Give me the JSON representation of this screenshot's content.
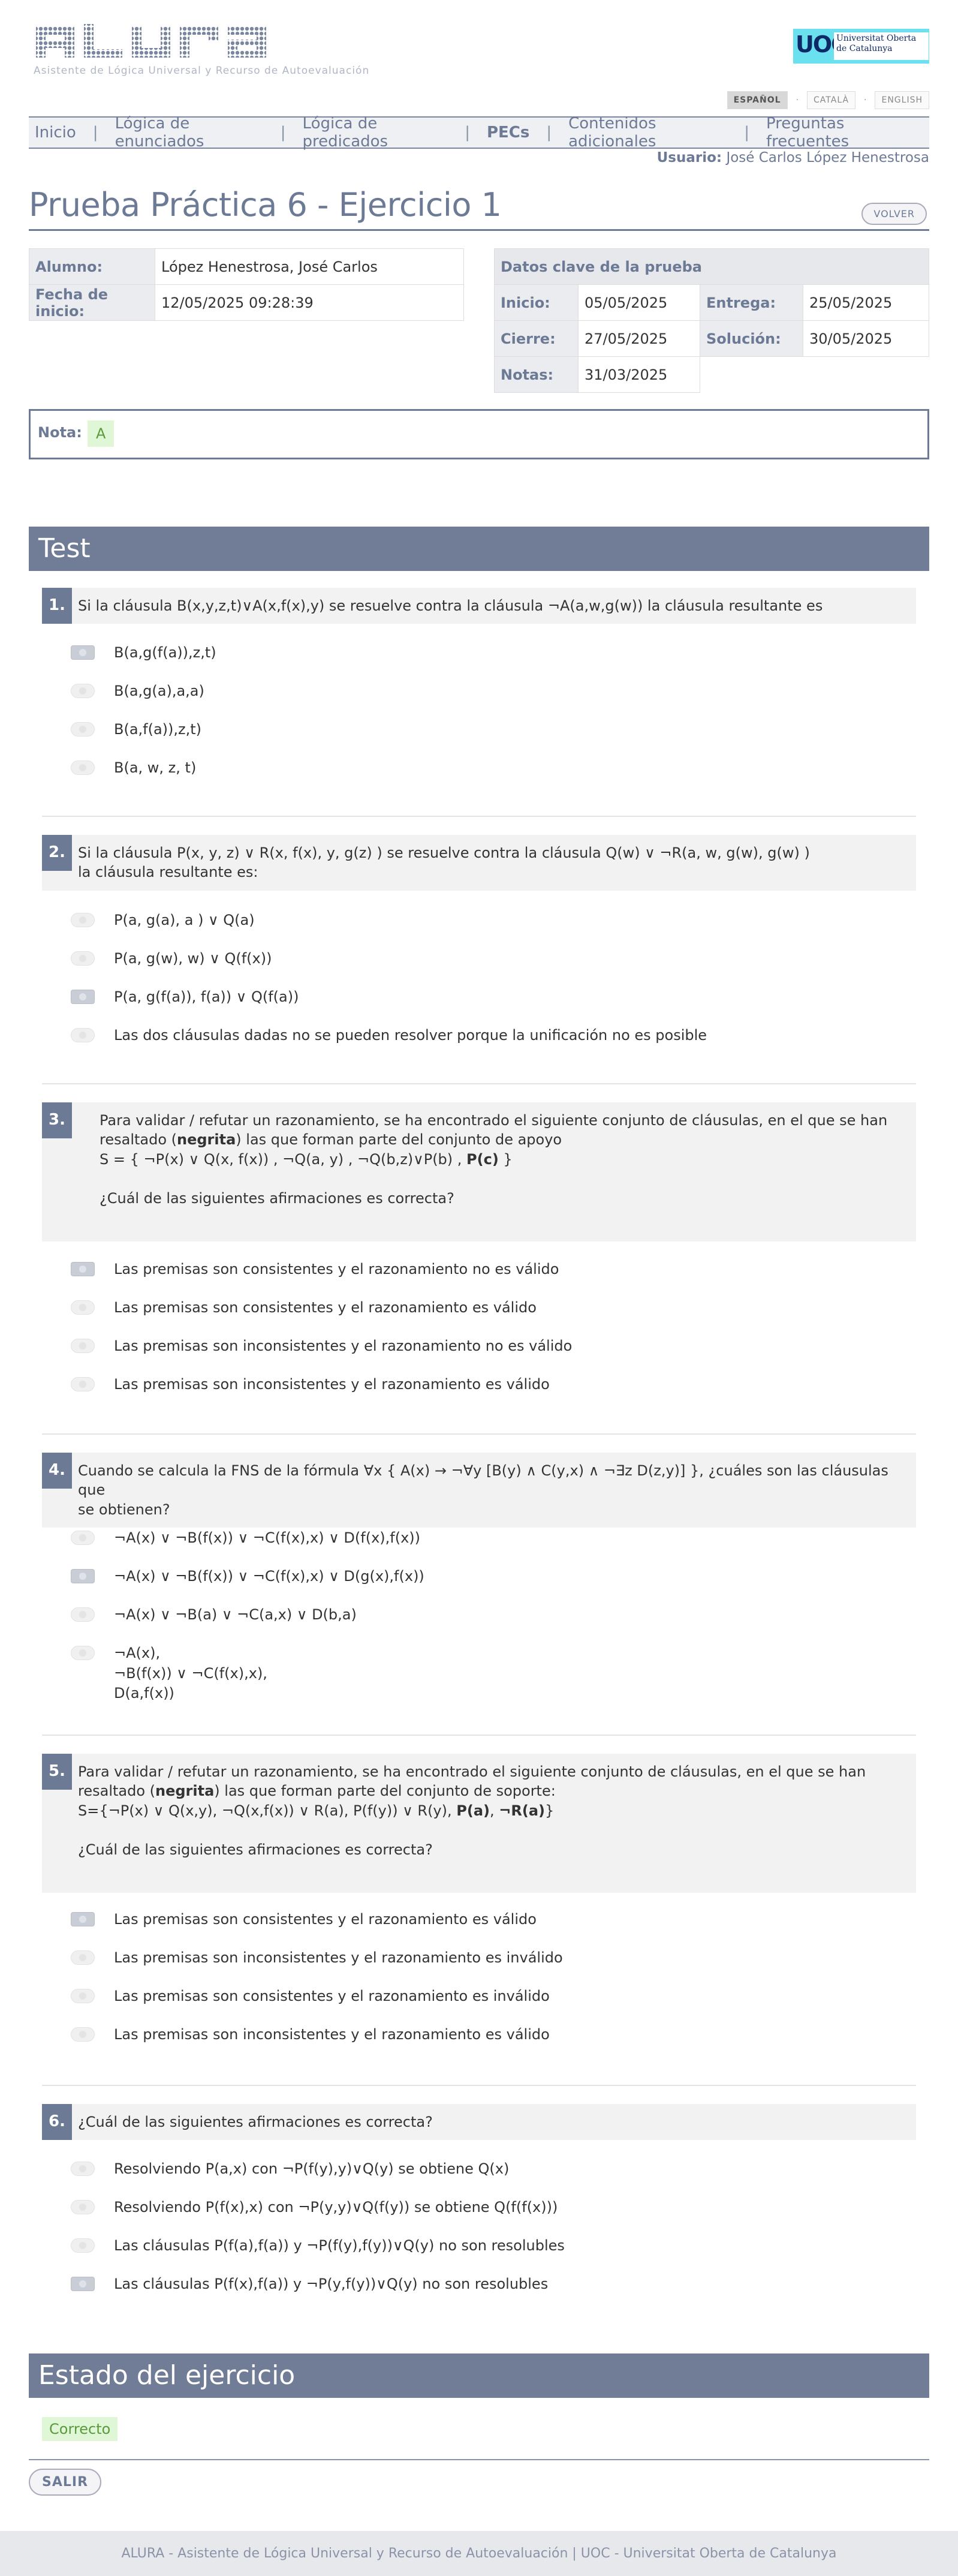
{
  "app": {
    "logo_text": "ALURA",
    "logo_subtitle": "Asistente de Lógica Universal y Recurso de Autoevaluación",
    "university": "Universitat Oberta de Catalunya"
  },
  "languages": [
    "ESPAÑOL",
    "CATALÀ",
    "ENGLISH"
  ],
  "nav": [
    "Inicio",
    "Lógica de enunciados",
    "Lógica de predicados",
    "PECs",
    "Contenidos adicionales",
    "Preguntas frecuentes"
  ],
  "user": {
    "label": "Usuario:",
    "name": "José Carlos López Henestrosa"
  },
  "page_title": "Prueba Práctica 6 - Ejercicio 1",
  "back_button": "VOLVER",
  "student": {
    "alumno_label": "Alumno:",
    "alumno": "López Henestrosa, José Carlos",
    "fecha_label": "Fecha de inicio:",
    "fecha": "12/05/2025 09:28:39"
  },
  "key_dates": {
    "heading": "Datos clave de la prueba",
    "inicio_label": "Inicio:",
    "inicio": "05/05/2025",
    "entrega_label": "Entrega:",
    "entrega": "25/05/2025",
    "cierre_label": "Cierre:",
    "cierre": "27/05/2025",
    "solucion_label": "Solución:",
    "solucion": "30/05/2025",
    "notas_label": "Notas:",
    "notas": "31/03/2025"
  },
  "nota": {
    "label": "Nota:",
    "value": "A"
  },
  "test_heading": "Test",
  "questions": [
    {
      "n": "1.",
      "text": "Si la cláusula B(x,y,z,t)∨A(x,f(x),y) se resuelve contra la cláusula ¬A(a,w,g(w)) la cláusula resultante es",
      "options": [
        "B(a,g(f(a)),z,t)",
        "B(a,g(a),a,a)",
        "B(a,f(a)),z,t)",
        "B(a, w, z, t)"
      ],
      "selected": 0
    },
    {
      "n": "2.",
      "text": "Si la cláusula   P(x, y, z) ∨ R(x, f(x), y, g(z) )  se resuelve contra la cláusula Q(w) ∨ ¬R(a, w, g(w), g(w) )",
      "text2": "la cláusula resultante es:",
      "options": [
        "P(a, g(a), a ) ∨ Q(a)",
        "P(a, g(w), w) ∨ Q(f(x))",
        "P(a, g(f(a)), f(a)) ∨ Q(f(a))",
        "Las dos cláusulas dadas no se pueden resolver porque la unificación no es posible"
      ],
      "selected": 2
    },
    {
      "n": "3.",
      "text": "Para validar / refutar un razonamiento, se ha encontrado el siguiente conjunto de cláusulas, en el que se han",
      "text2_a": "resaltado (",
      "text2_b": "negrita",
      "text2_c": ") las que forman parte del conjunto de apoyo",
      "text3": "S = { ¬P(x) ∨ Q(x, f(x)) ,   ¬Q(a, y) ,     ¬Q(b,z)∨P(b) ,    ",
      "text3_bold": "P(c)",
      "text3_end": "   }",
      "text4": "¿Cuál de las siguientes afirmaciones es correcta?",
      "options": [
        "Las premisas son consistentes y el razonamiento no es válido",
        "Las premisas son consistentes y el razonamiento es válido",
        "Las premisas son inconsistentes y el razonamiento no es válido",
        "Las premisas son inconsistentes y el razonamiento es válido"
      ],
      "selected": 0
    },
    {
      "n": "4.",
      "text": "Cuando se calcula la FNS de la fórmula ∀x { A(x) → ¬∀y [B(y) ∧ C(y,x) ∧ ¬∃z D(z,y)] }, ¿cuáles son las cláusulas que",
      "text2": "se obtienen?",
      "options": [
        "¬A(x) ∨ ¬B(f(x)) ∨ ¬C(f(x),x) ∨ D(f(x),f(x))",
        "¬A(x) ∨ ¬B(f(x)) ∨ ¬C(f(x),x) ∨ D(g(x),f(x))",
        "¬A(x) ∨ ¬B(a) ∨ ¬C(a,x) ∨ D(b,a)"
      ],
      "option4": [
        "¬A(x),",
        "¬B(f(x)) ∨ ¬C(f(x),x),",
        "D(a,f(x))"
      ],
      "selected": 1
    },
    {
      "n": "5.",
      "text": "Para validar / refutar un razonamiento, se ha encontrado el siguiente conjunto de cláusulas, en el que se han",
      "text2_a": "resaltado (",
      "text2_b": "negrita",
      "text2_c": ") las que forman parte del conjunto de soporte:",
      "text3": "S={¬P(x) ∨ Q(x,y),   ¬Q(x,f(x)) ∨ R(a),    P(f(y)) ∨ R(y),   ",
      "text3_bold": "P(a)",
      "text3_mid": ",   ",
      "text3_bold2": "¬R(a)",
      "text3_end": "}",
      "text4": "¿Cuál de las siguientes afirmaciones es correcta?",
      "options": [
        "Las premisas son consistentes y el razonamiento es válido",
        "Las premisas son inconsistentes y el razonamiento es inválido",
        "Las premisas son consistentes y el razonamiento es inválido",
        "Las premisas son inconsistentes y el razonamiento es válido"
      ],
      "selected": 0
    },
    {
      "n": "6.",
      "text": "¿Cuál de las siguientes afirmaciones es correcta?",
      "options": [
        "Resolviendo P(a,x)   con   ¬P(f(y),y)∨Q(y) se obtiene Q(x)",
        "Resolviendo P(f(x),x) con ¬P(y,y)∨Q(f(y)) se obtiene Q(f(f(x)))",
        "Las cláusulas P(f(a),f(a))  y  ¬P(f(y),f(y))∨Q(y)  no son resolubles",
        "Las cláusulas P(f(x),f(a))  y  ¬P(y,f(y))∨Q(y)  no son resolubles"
      ],
      "selected": 3
    }
  ],
  "estado_heading": "Estado del ejercicio",
  "estado": "Correcto",
  "exit_button": "SALIR",
  "footer": "ALURA - Asistente de Lógica Universal y Recurso de Autoevaluación | UOC - Universitat Oberta de Catalunya",
  "colors": {
    "accent": "#717d97",
    "success_bg": "#dff7d6",
    "success_text": "#5a9a3d"
  }
}
